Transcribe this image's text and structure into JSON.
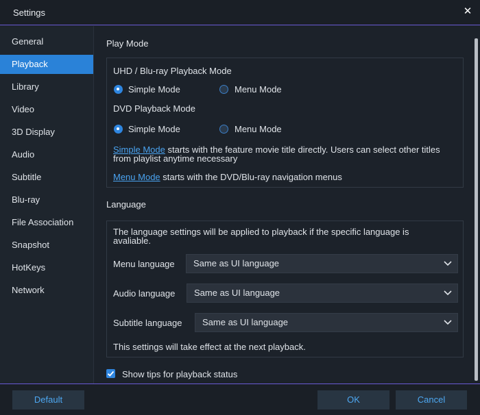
{
  "window": {
    "title": "Settings",
    "close_glyph": "✕"
  },
  "sidebar": {
    "items": [
      {
        "label": "General"
      },
      {
        "label": "Playback",
        "active": true
      },
      {
        "label": "Library"
      },
      {
        "label": "Video"
      },
      {
        "label": "3D Display"
      },
      {
        "label": "Audio"
      },
      {
        "label": "Subtitle"
      },
      {
        "label": "Blu-ray"
      },
      {
        "label": "File Association"
      },
      {
        "label": "Snapshot"
      },
      {
        "label": "HotKeys"
      },
      {
        "label": "Network"
      }
    ]
  },
  "play_mode": {
    "section_title": "Play Mode",
    "uhd_label": "UHD / Blu-ray Playback Mode",
    "uhd_options": [
      {
        "label": "Simple Mode",
        "checked": true
      },
      {
        "label": "Menu Mode",
        "checked": false
      }
    ],
    "dvd_label": "DVD Playback Mode",
    "dvd_options": [
      {
        "label": "Simple Mode",
        "checked": true
      },
      {
        "label": "Menu Mode",
        "checked": false
      }
    ],
    "simple_link": "Simple Mode",
    "simple_desc_line1": " starts with the feature movie title directly. Users can select other titles",
    "simple_desc_line2": "from playlist anytime necessary",
    "menu_link": "Menu Mode",
    "menu_desc": " starts with the DVD/Blu-ray navigation menus"
  },
  "language": {
    "section_title": "Language",
    "note_line1": "The language settings will be applied to playback if the specific language is",
    "note_line2": "avaliable.",
    "menu_language_label": "Menu language",
    "menu_language_value": "Same as UI language",
    "audio_language_label": "Audio language",
    "audio_language_value": "Same as UI language",
    "subtitle_language_label": "Subtitle language",
    "subtitle_language_value": "Same as UI language",
    "effect_note": "This settings will take effect at the next playback."
  },
  "tips": {
    "label": "Show tips for playback status",
    "checked": true
  },
  "footer": {
    "default_label": "Default",
    "ok_label": "OK",
    "cancel_label": "Cancel"
  },
  "colors": {
    "accent": "#2a82d8",
    "link": "#4aa3f0",
    "divider": "#6a5ad6",
    "background": "#1c222a"
  }
}
